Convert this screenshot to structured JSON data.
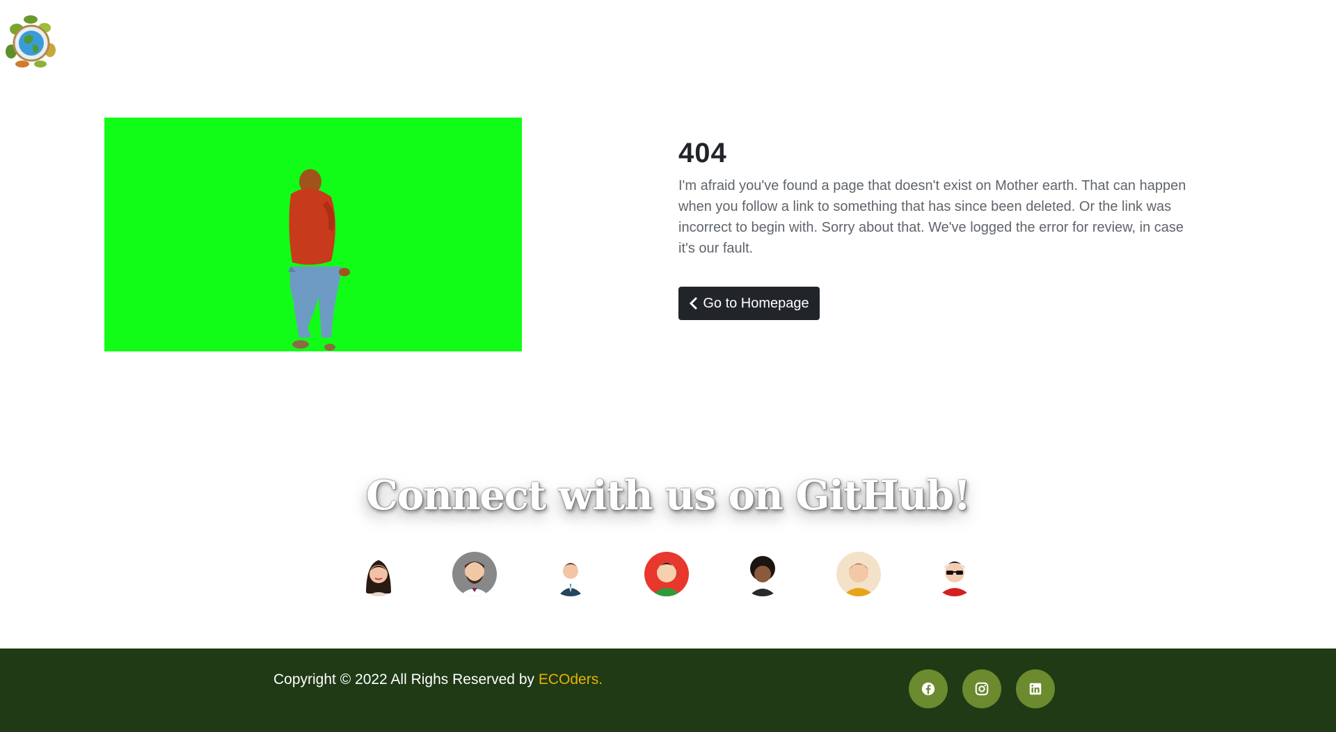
{
  "error": {
    "code": "404",
    "message": "I'm afraid you've found a page that doesn't exist on Mother earth. That can happen when you follow a link to something that has since been deleted. Or the link was incorrect to begin with. Sorry about that. We've logged the error for review, in case it's our fault.",
    "button_label": "Go to Homepage",
    "button_icon": "chevron-left-icon"
  },
  "hero": {
    "background_color": "#11fd18"
  },
  "connect": {
    "heading": "Connect with us on GitHub!",
    "avatars": [
      {
        "name": "contributor-1",
        "bg": "#ffffff"
      },
      {
        "name": "contributor-2",
        "bg": "#888888"
      },
      {
        "name": "contributor-3",
        "bg": "#ffffff"
      },
      {
        "name": "contributor-4",
        "bg": "#e8372c"
      },
      {
        "name": "contributor-5",
        "bg": "#ffffff"
      },
      {
        "name": "contributor-6",
        "bg": "#f3e2c8"
      },
      {
        "name": "contributor-7",
        "bg": "#ffffff"
      }
    ]
  },
  "footer": {
    "copyright_prefix": "Copyright © 2022 All Righs Reserved by ",
    "brand": "ECOders.",
    "social": [
      {
        "icon": "facebook-icon"
      },
      {
        "icon": "instagram-icon"
      },
      {
        "icon": "linkedin-icon"
      }
    ],
    "colors": {
      "background": "#1f3a15",
      "brand": "#e8b200",
      "social_bg": "#6c8a2e"
    }
  }
}
